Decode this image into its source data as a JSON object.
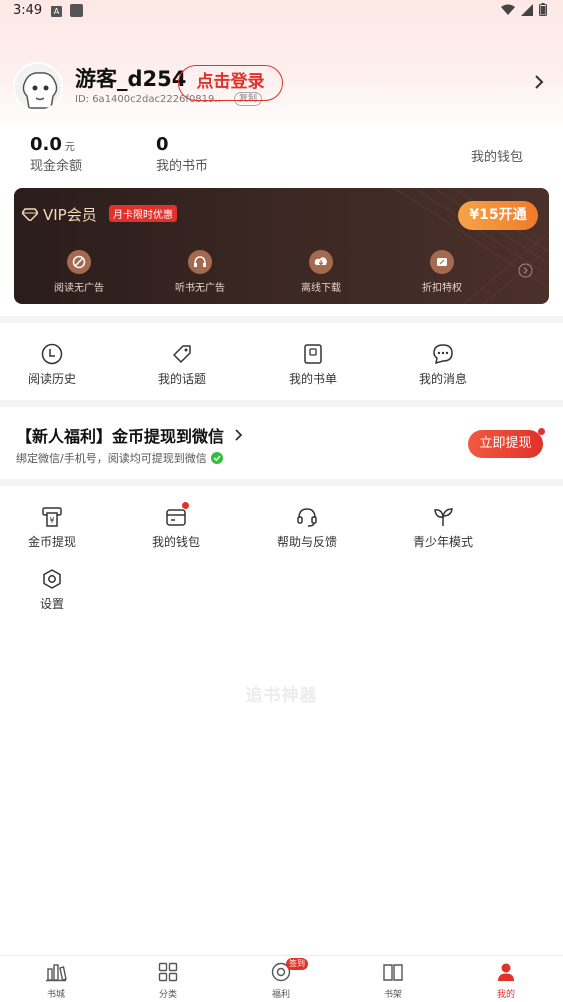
{
  "status_bar": {
    "time": "3:49",
    "a_icon": "A"
  },
  "profile": {
    "username": "游客_d254",
    "user_id": "ID: 6a1400c2dac2226f0819...",
    "copy_label": "复制",
    "login_label": "点击登录"
  },
  "stats": {
    "cash_value": "0.0",
    "cash_unit": "元",
    "cash_label": "现金余额",
    "coins_value": "0",
    "coins_label": "我的书币",
    "wallet_label": "我的钱包"
  },
  "vip": {
    "title": "VIP会员",
    "promo": "月卡限时优惠",
    "open_label": "¥15开通",
    "benefits": [
      {
        "label": "阅读无广告",
        "icon": "no-ad-reading-icon"
      },
      {
        "label": "听书无广告",
        "icon": "no-ad-listening-icon"
      },
      {
        "label": "离线下载",
        "icon": "download-icon"
      },
      {
        "label": "折扣特权",
        "icon": "discount-icon"
      }
    ],
    "accent": "#f5a44a"
  },
  "quick_menu": [
    {
      "label": "阅读历史",
      "icon": "clock-icon"
    },
    {
      "label": "我的话题",
      "icon": "tag-icon"
    },
    {
      "label": "我的书单",
      "icon": "booklist-icon"
    },
    {
      "label": "我的消息",
      "icon": "message-icon"
    }
  ],
  "welfare": {
    "title": "【新人福利】金币提现到微信",
    "subtitle": "绑定微信/手机号，阅读均可提现到微信",
    "button": "立即提现"
  },
  "tools": [
    {
      "label": "金币提现",
      "icon": "coin-withdraw-icon"
    },
    {
      "label": "我的钱包",
      "icon": "wallet-icon"
    },
    {
      "label": "帮助与反馈",
      "icon": "headset-icon"
    },
    {
      "label": "青少年模式",
      "icon": "sprout-icon"
    },
    {
      "label": "设置",
      "icon": "settings-icon"
    }
  ],
  "watermark": "追书神器",
  "tabbar": {
    "tabs": [
      {
        "label": "书城",
        "icon": "bookstore-icon"
      },
      {
        "label": "分类",
        "icon": "category-icon"
      },
      {
        "label": "福利",
        "icon": "welfare-icon"
      },
      {
        "label": "书架",
        "icon": "bookshelf-icon"
      },
      {
        "label": "我的",
        "icon": "profile-icon"
      }
    ],
    "sign_badge": "签到",
    "active_color": "#e0312b"
  }
}
